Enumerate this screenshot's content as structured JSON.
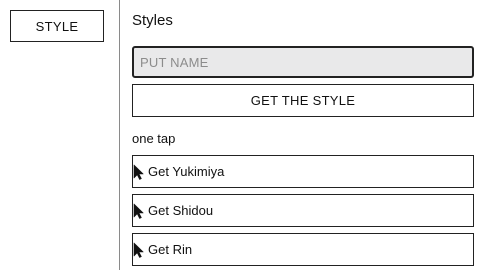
{
  "sidebar": {
    "style_button": "STYLE"
  },
  "main": {
    "heading": "Styles",
    "name_input": {
      "placeholder": "PUT NAME",
      "value": ""
    },
    "get_style_button": "GET THE STYLE",
    "section_label": "one tap",
    "one_tap_items": [
      {
        "label": "Get Yukimiya",
        "icon": "cursor-arrow-icon"
      },
      {
        "label": "Get Shidou",
        "icon": "cursor-arrow-icon"
      },
      {
        "label": "Get Rin",
        "icon": "cursor-arrow-icon"
      }
    ]
  }
}
